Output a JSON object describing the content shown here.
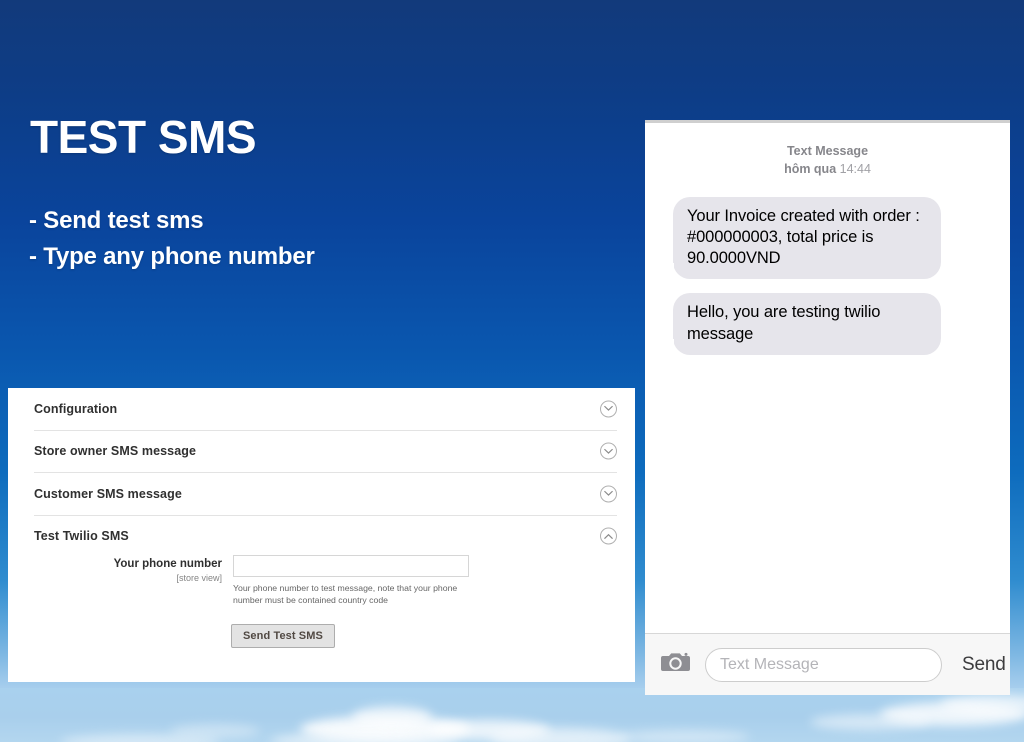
{
  "slide": {
    "headline": "TEST SMS",
    "bullets": [
      "- Send test sms",
      "- Type any phone number"
    ]
  },
  "config_panel": {
    "sections": [
      {
        "label": "Configuration",
        "expanded": false,
        "icon": "chevron-down-icon"
      },
      {
        "label": "Store owner SMS message",
        "expanded": false,
        "icon": "chevron-down-icon"
      },
      {
        "label": "Customer SMS message",
        "expanded": false,
        "icon": "chevron-down-icon"
      },
      {
        "label": "Test Twilio SMS",
        "expanded": true,
        "icon": "chevron-up-icon"
      }
    ],
    "form": {
      "field_label": "Your phone number",
      "field_scope": "[store view]",
      "field_value": "",
      "field_placeholder": "",
      "field_hint": "Your phone number to test message, note that your phone number must be contained country code",
      "submit_label": "Send Test SMS"
    }
  },
  "sms_panel": {
    "meta_label": "Text Message",
    "meta_day": "hôm qua",
    "meta_time": "14:44",
    "messages": [
      "Your Invoice created with order : #000000003, total price is 90.0000VND",
      "Hello, you are testing twilio message"
    ],
    "compose": {
      "camera_icon": "camera-icon",
      "input_value": "",
      "input_placeholder": "Text Message",
      "send_label": "Send"
    }
  },
  "colors": {
    "sky_dark": "#123a7b",
    "sky_mid": "#0a56ae",
    "sky_light": "#a9cfee",
    "bubble_gray": "#e6e5eb",
    "panel_white": "#ffffff"
  }
}
